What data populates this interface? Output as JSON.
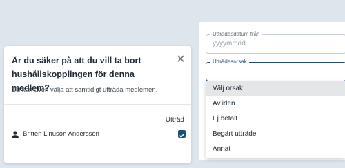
{
  "form": {
    "date_label": "Utträdesdatum från",
    "date_placeholder": "yyyymmdd",
    "reason_label": "Utträdesorsak",
    "options": [
      "Välj orsak",
      "Avliden",
      "Ej betalt",
      "Begärt utträde",
      "Annat"
    ],
    "selected_option": "Välj orsak"
  },
  "dialog": {
    "title": "Är du säker på att du vill ta bort hushållskopplingen för denna medlem?",
    "description": "Du kan även välja att samtidigt utträda medlemen.",
    "column_header": "Utträd",
    "member_name": "Britten Linuson Andersson",
    "member_checked": true
  },
  "colors": {
    "accent": "#1f4e7a",
    "background": "#dce6ec"
  }
}
